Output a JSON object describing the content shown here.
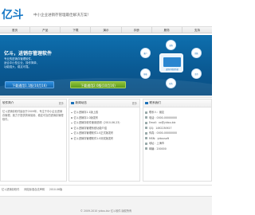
{
  "brand": {
    "logo_text": "亿斗",
    "slogan": "中小企业进销存管理最佳解决方案！"
  },
  "nav": {
    "items": [
      "首页",
      "产品",
      "下载",
      "演示",
      "手册",
      "服务",
      "支持"
    ]
  },
  "banner": {
    "title": "亿斗，进销存管理软件",
    "lines": [
      "专业的进销存管理软件，",
      "适合中小型企业，操作简单，",
      "功能强大，稳定可靠。"
    ],
    "btn_download_1": "下载通用1.1版(10月16)",
    "btn_download_2": "下载通用2.0版(10月16)",
    "diagram_nodes": [
      "采购",
      "销售",
      "库存",
      "财务",
      "报表",
      "客户"
    ],
    "diagram_center": "进销存管理系统"
  },
  "about": {
    "heading": "软件简介",
    "more": "更多",
    "text": "亿斗进销存软件始创于2009年，专注于中小企业进销存管理，致力于提供简单易用、稳定可靠的进销存管理软件。"
  },
  "news": {
    "heading": "新闻动态",
    "more": "更多",
    "items": [
      "亿斗进销存1.1版上线",
      "亿斗进销存1.0版发布",
      "亿斗进销存软件使用说明（2010-06-23）",
      "亿斗进销存管理系统功能介绍",
      "亿斗进销存管理软件1.0正式版发布",
      "亿斗进销存管理软件1.0测试版发布"
    ]
  },
  "contact": {
    "heading": "联系我们",
    "rows": [
      "联系人：朋友",
      "电话：0000-00000000",
      "Email：xx@yidou.biz",
      "QQ：1492230927",
      "传真：0000-00000000",
      "MSN：yidousoft",
      "地址：上海市",
      "邮编：200000"
    ]
  },
  "links": {
    "items": [
      "亿斗进销存软件",
      "网站标准合法声明",
      "2010.06版"
    ]
  },
  "footer": {
    "copyright": "© 2009-2010 yidou.biz 亿斗软件 版权所有"
  }
}
